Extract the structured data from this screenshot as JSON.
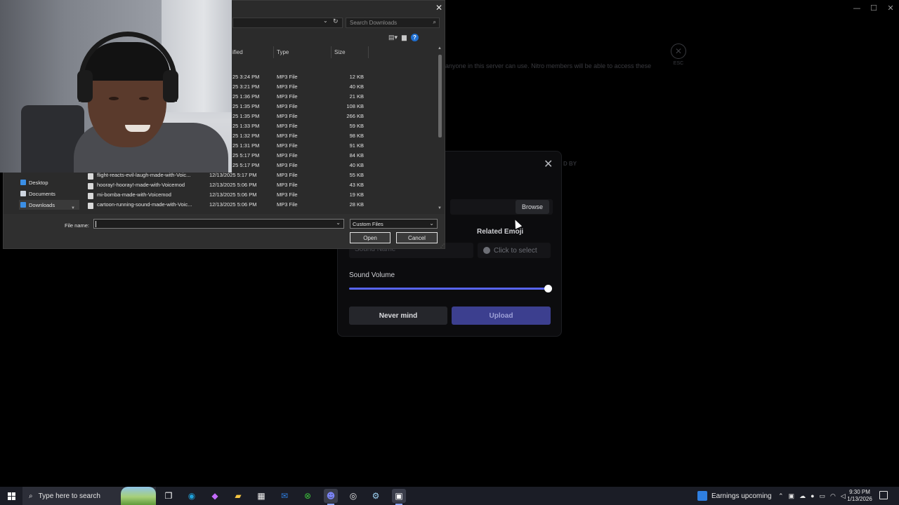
{
  "window_controls": {
    "minimize": "—",
    "maximize": "☐",
    "close": "✕"
  },
  "discord_bg": {
    "info_text": "anyone in this server can use. Nitro members will be able to access these",
    "esc_icon": "✕",
    "esc_label": "ESC",
    "column_label": "D BY"
  },
  "upload_modal": {
    "close_icon": "✕",
    "browse_label": "Browse",
    "related_emoji_label": "Related Emoji",
    "sound_name_placeholder": "Sound Name",
    "emoji_select_label": "Click to select",
    "volume_label": "Sound Volume",
    "volume_level": 1.0,
    "nevermind_label": "Never mind",
    "upload_label": "Upload",
    "accent_color": "#5865f2"
  },
  "file_dialog": {
    "close_icon": "✕",
    "search_placeholder": "Search Downloads",
    "columns": {
      "modified": "ified",
      "type": "Type",
      "size": "Size"
    },
    "rows": [
      {
        "name": "",
        "date": "25 3:24 PM",
        "type": "MP3 File",
        "size": "12 KB"
      },
      {
        "name": "",
        "date": "25 3:21 PM",
        "type": "MP3 File",
        "size": "40 KB"
      },
      {
        "name": "",
        "date": "25 1:36 PM",
        "type": "MP3 File",
        "size": "21 KB"
      },
      {
        "name": "",
        "date": "25 1:35 PM",
        "type": "MP3 File",
        "size": "108 KB"
      },
      {
        "name": "",
        "date": "25 1:35 PM",
        "type": "MP3 File",
        "size": "266 KB"
      },
      {
        "name": "",
        "date": "25 1:33 PM",
        "type": "MP3 File",
        "size": "59 KB"
      },
      {
        "name": "",
        "date": "25 1:32 PM",
        "type": "MP3 File",
        "size": "98 KB"
      },
      {
        "name": "",
        "date": "25 1:31 PM",
        "type": "MP3 File",
        "size": "91 KB"
      },
      {
        "name": "",
        "date": "25 5:17 PM",
        "type": "MP3 File",
        "size": "84 KB"
      },
      {
        "name": "",
        "date": "25 5:17 PM",
        "type": "MP3 File",
        "size": "40 KB"
      },
      {
        "name": "flight-reacts-evil-laugh-made-with-Voic...",
        "date": "12/13/2025 5:17 PM",
        "type": "MP3 File",
        "size": "55 KB"
      },
      {
        "name": "hooray!-hooray!-made-with-Voicemod",
        "date": "12/13/2025 5:06 PM",
        "type": "MP3 File",
        "size": "43 KB"
      },
      {
        "name": "mi-bomba-made-with-Voicemod",
        "date": "12/13/2025 5:06 PM",
        "type": "MP3 File",
        "size": "19 KB"
      },
      {
        "name": "cartoon-running-sound-made-with-Voic...",
        "date": "12/13/2025 5:06 PM",
        "type": "MP3 File",
        "size": "28 KB"
      }
    ],
    "nav": [
      {
        "label": "Desktop",
        "color": "#3b8fe6"
      },
      {
        "label": "Documents",
        "color": "#cfd6e0"
      },
      {
        "label": "Downloads",
        "color": "#3b8fe6"
      }
    ],
    "file_name_label": "File name:",
    "file_name_value": "",
    "filter_value": "Custom Files",
    "open_label": "Open",
    "cancel_label": "Cancel"
  },
  "taskbar": {
    "search_placeholder": "Type here to search",
    "news_label": "Earnings upcoming",
    "time": "9:30 PM",
    "date": "1/13/2026",
    "apps": [
      {
        "name": "task-view-icon",
        "glyph": "❐",
        "active": false
      },
      {
        "name": "edge-icon",
        "glyph": "◉",
        "color": "#1fa0d8",
        "active": false
      },
      {
        "name": "copilot-icon",
        "glyph": "◆",
        "color": "#c46bff",
        "active": false
      },
      {
        "name": "file-explorer-icon",
        "glyph": "▰",
        "color": "#f5c542",
        "active": false
      },
      {
        "name": "store-icon",
        "glyph": "▦",
        "color": "#f0f0f0",
        "active": false
      },
      {
        "name": "outlook-icon",
        "glyph": "✉",
        "color": "#2e7de0",
        "active": false
      },
      {
        "name": "xbox-icon",
        "glyph": "⊗",
        "color": "#3cc13b",
        "active": false
      },
      {
        "name": "discord-icon",
        "glyph": "☻",
        "color": "#7b84f6",
        "active": true
      },
      {
        "name": "obs-icon",
        "glyph": "◎",
        "color": "#e6e6e6",
        "active": false
      },
      {
        "name": "steam-icon",
        "glyph": "⚙",
        "color": "#9fd3f5",
        "active": false
      },
      {
        "name": "capcut-icon",
        "glyph": "▣",
        "color": "#ffffff",
        "active": true
      }
    ]
  }
}
